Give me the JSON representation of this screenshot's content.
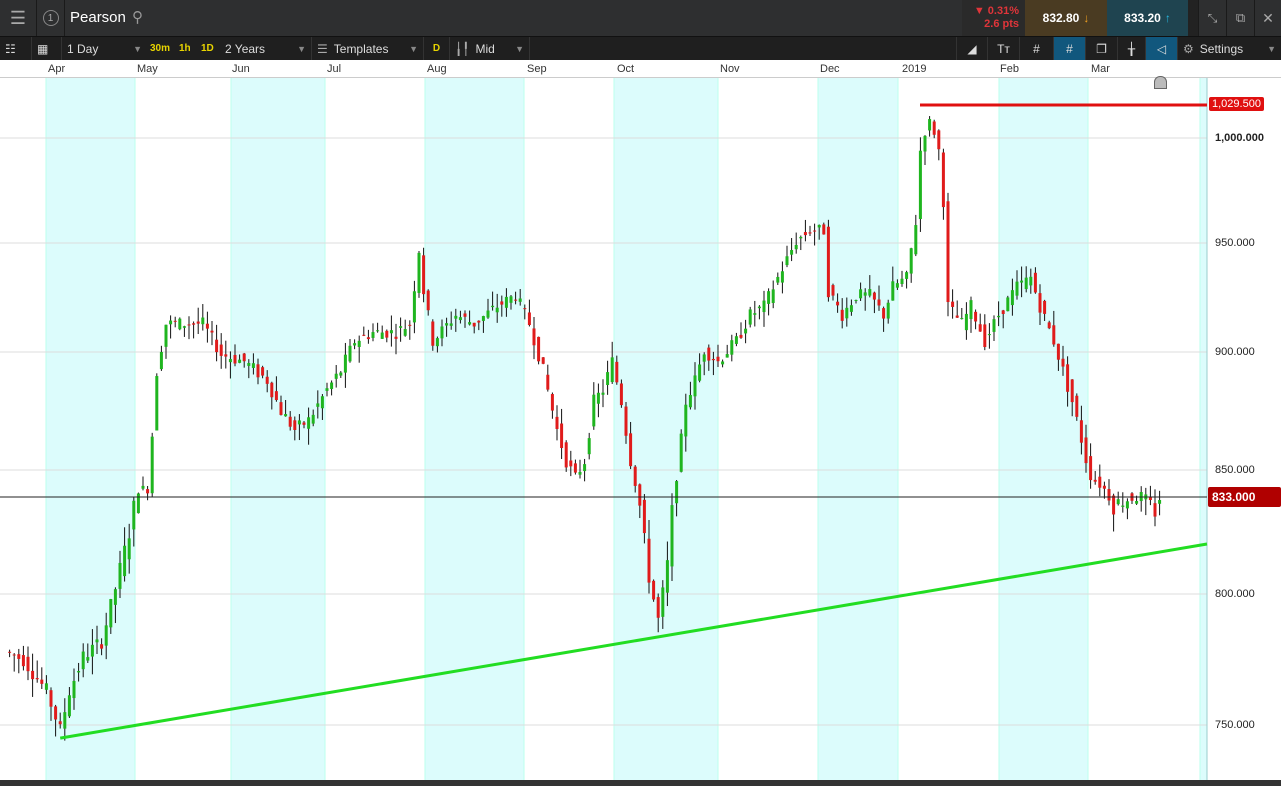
{
  "topbar": {
    "instrument": "Pearson",
    "window_number": "1",
    "change_pct": "▼ 0.31%",
    "change_pts": "2.6 pts",
    "sell_price": "832.80",
    "buy_price": "833.20"
  },
  "toolbar": {
    "interval": "1 Day",
    "quick_30m": "30m",
    "quick_1h": "1h",
    "quick_1d": "1D",
    "range": "2 Years",
    "templates": "Templates",
    "d_badge": "D",
    "price_type": "Mid",
    "settings": "Settings"
  },
  "months": [
    "Apr",
    "May",
    "Jun",
    "Jul",
    "Aug",
    "Sep",
    "Oct",
    "Nov",
    "Dec",
    "2019",
    "Feb",
    "Mar"
  ],
  "colors": {
    "up": "#1fb51f",
    "down": "#e01b1b",
    "trend": "#22dd22",
    "resistance": "#e01010",
    "band": "#dcfcfc"
  },
  "chart_data": {
    "type": "candlestick",
    "y_ticks": [
      "1,000.000",
      "950.000",
      "900.000",
      "850.000",
      "800.000",
      "750.000"
    ],
    "resistance_label": "1,029.500",
    "current_label": "833.000",
    "resistance": 1029.5,
    "current": 833,
    "trendline": {
      "from": [
        12,
        745
      ],
      "to": [
        262,
        817
      ]
    },
    "path": [
      [
        0,
        778
      ],
      [
        4,
        775
      ],
      [
        9,
        763
      ],
      [
        12,
        748
      ],
      [
        14,
        763
      ],
      [
        17,
        776
      ],
      [
        21,
        782
      ],
      [
        24,
        802
      ],
      [
        27,
        821
      ],
      [
        29,
        838
      ],
      [
        31,
        838
      ],
      [
        33,
        892
      ],
      [
        35,
        913
      ],
      [
        39,
        913
      ],
      [
        43,
        913
      ],
      [
        47,
        899
      ],
      [
        52,
        896
      ],
      [
        57,
        888
      ],
      [
        60,
        875
      ],
      [
        63,
        867
      ],
      [
        66,
        871
      ],
      [
        70,
        884
      ],
      [
        73,
        892
      ],
      [
        76,
        905
      ],
      [
        80,
        909
      ],
      [
        85,
        909
      ],
      [
        88,
        913
      ],
      [
        90,
        947
      ],
      [
        91,
        928
      ],
      [
        93,
        905
      ],
      [
        98,
        917
      ],
      [
        102,
        913
      ],
      [
        107,
        921
      ],
      [
        111,
        926
      ],
      [
        114,
        913
      ],
      [
        117,
        892
      ],
      [
        120,
        867
      ],
      [
        122,
        854
      ],
      [
        124,
        846
      ],
      [
        126,
        854
      ],
      [
        128,
        879
      ],
      [
        130,
        884
      ],
      [
        132,
        896
      ],
      [
        134,
        879
      ],
      [
        136,
        854
      ],
      [
        138,
        830
      ],
      [
        140,
        806
      ],
      [
        142,
        790
      ],
      [
        144,
        810
      ],
      [
        146,
        846
      ],
      [
        148,
        879
      ],
      [
        150,
        888
      ],
      [
        152,
        901
      ],
      [
        155,
        896
      ],
      [
        159,
        905
      ],
      [
        162,
        917
      ],
      [
        165,
        921
      ],
      [
        168,
        934
      ],
      [
        172,
        951
      ],
      [
        175,
        956
      ],
      [
        178,
        956
      ],
      [
        179,
        928
      ],
      [
        182,
        917
      ],
      [
        185,
        926
      ],
      [
        188,
        926
      ],
      [
        191,
        917
      ],
      [
        193,
        930
      ],
      [
        196,
        934
      ],
      [
        198,
        960
      ],
      [
        199,
        994
      ],
      [
        201,
        1015
      ],
      [
        203,
        994
      ],
      [
        204,
        970
      ],
      [
        205,
        921
      ],
      [
        208,
        913
      ],
      [
        210,
        921
      ],
      [
        213,
        905
      ],
      [
        216,
        917
      ],
      [
        220,
        930
      ],
      [
        223,
        934
      ],
      [
        225,
        921
      ],
      [
        228,
        905
      ],
      [
        232,
        879
      ],
      [
        234,
        863
      ],
      [
        236,
        846
      ],
      [
        239,
        838
      ],
      [
        241,
        830
      ],
      [
        243,
        832
      ],
      [
        247,
        834
      ],
      [
        250,
        828
      ],
      [
        251,
        833
      ]
    ]
  }
}
